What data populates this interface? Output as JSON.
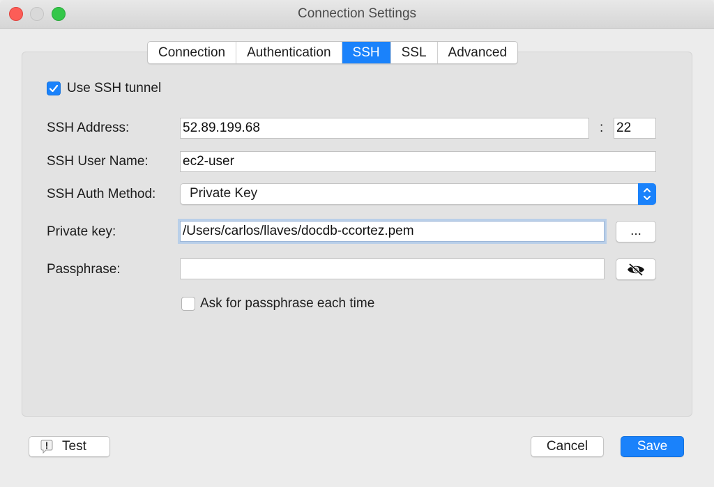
{
  "window": {
    "title": "Connection Settings"
  },
  "tabs": [
    {
      "label": "Connection",
      "active": false
    },
    {
      "label": "Authentication",
      "active": false
    },
    {
      "label": "SSH",
      "active": true
    },
    {
      "label": "SSL",
      "active": false
    },
    {
      "label": "Advanced",
      "active": false
    }
  ],
  "ssh": {
    "use_tunnel_label": "Use SSH tunnel",
    "use_tunnel_checked": true,
    "address_label": "SSH Address:",
    "address_value": "52.89.199.68",
    "port_separator": ":",
    "port_value": "22",
    "user_label": "SSH User Name:",
    "user_value": "ec2-user",
    "auth_label": "SSH Auth Method:",
    "auth_value": "Private Key",
    "key_label": "Private key:",
    "key_value": "/Users/carlos/llaves/docdb-ccortez.pem",
    "browse_label": "...",
    "passphrase_label": "Passphrase:",
    "passphrase_value": "",
    "ask_label": "Ask for passphrase each time",
    "ask_checked": false
  },
  "footer": {
    "test_label": "Test",
    "cancel_label": "Cancel",
    "save_label": "Save"
  },
  "colors": {
    "accent": "#1a82fb"
  },
  "icons": {
    "checkbox": "checkmark-icon",
    "browse": "ellipsis",
    "reveal": "eye-slash-icon",
    "test": "warning-icon",
    "select": "chevron-up-down-icon"
  }
}
